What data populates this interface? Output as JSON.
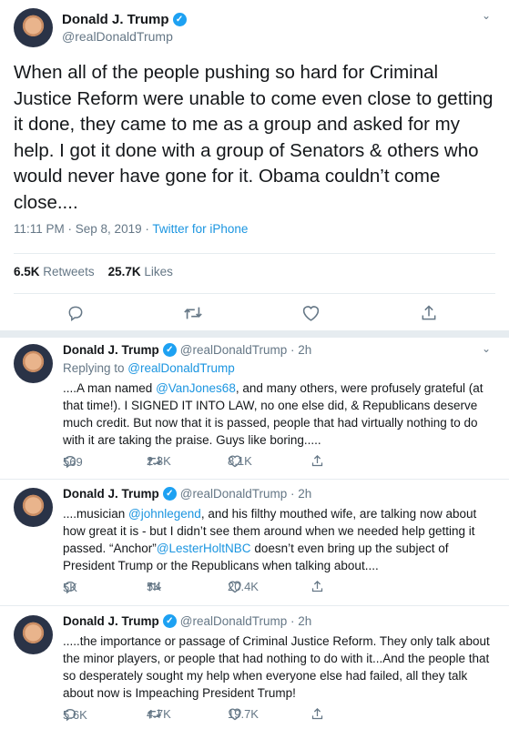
{
  "main_tweet": {
    "name": "Donald J. Trump",
    "handle": "@realDonaldTrump",
    "text": "When all of the people pushing so hard for Criminal Justice Reform were  unable to come even close to getting it done, they came to me as a group and asked for my help. I got it done with a group of Senators & others who would never have gone for it. Obama couldn’t come close....",
    "time": "11:11 PM · Sep 8, 2019 · ",
    "source": "Twitter for iPhone",
    "retweets_count": "6.5K",
    "retweets_label": "Retweets",
    "likes_count": "25.7K",
    "likes_label": "Likes"
  },
  "replies": [
    {
      "name": "Donald J. Trump",
      "handle": "@realDonaldTrump · 2h",
      "replying_label": "Replying to ",
      "replying_to": "@realDonaldTrump",
      "text_a": "....A man named ",
      "mention": "@VanJones68",
      "text_b": ", and many others, were profusely grateful (at that time!). I SIGNED IT INTO LAW, no one else did, & Republicans deserve much credit. But now that it is passed, people that had virtually nothing to do with it are taking the praise. Guys like boring.....",
      "replies_count": "569",
      "retweets_count": "2.3K",
      "likes_count": "8.1K"
    },
    {
      "name": "Donald J. Trump",
      "handle": "@realDonaldTrump · 2h",
      "text_a": "....musician ",
      "mention": "@johnlegend",
      "text_b": ", and his filthy mouthed wife, are talking now about how great it is - but I didn’t see them around when we needed help getting it passed. “Anchor”",
      "mention2": "@LesterHoltNBC",
      "text_c": " doesn’t even bring up the subject of President Trump or the Republicans when talking about....",
      "replies_count": "5K",
      "retweets_count": "5K",
      "likes_count": "20.4K"
    },
    {
      "name": "Donald J. Trump",
      "handle": "@realDonaldTrump · 2h",
      "text_a": ".....the importance or passage of Criminal Justice Reform. They only talk about the minor players, or people that had nothing to do with it...And the people that so desperately sought my help when everyone else had failed, all they talk about now is Impeaching President Trump!",
      "replies_count": "5.6K",
      "retweets_count": "4.7K",
      "likes_count": "19.7K"
    }
  ],
  "icons": {
    "verified": "✓",
    "chevron": "⌄",
    "reply": "reply-icon",
    "retweet": "retweet-icon",
    "like": "heart-icon",
    "share": "share-icon"
  },
  "colors": {
    "link": "#1b95e0",
    "verified": "#1da1f2",
    "muted": "#657786"
  }
}
